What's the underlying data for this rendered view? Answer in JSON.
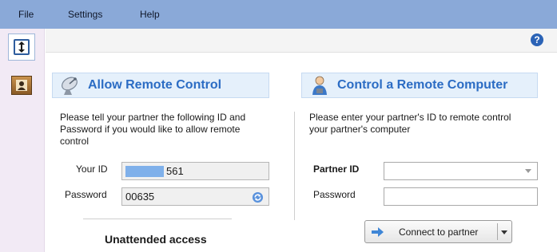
{
  "menu": {
    "file": "File",
    "settings": "Settings",
    "help": "Help"
  },
  "sidebar": {
    "items": [
      {
        "icon": "remote-control-arrows-icon",
        "active": true
      },
      {
        "icon": "contacts-book-icon",
        "active": false
      }
    ]
  },
  "toolbar": {
    "help_icon": "question-mark-icon",
    "help_glyph": "?"
  },
  "allow_panel": {
    "title": "Allow Remote Control",
    "icon": "satellite-dish-icon",
    "description": "Please tell your partner the following ID and Password if you would like to allow remote control",
    "your_id_label": "Your ID",
    "your_id_value": "561",
    "password_label": "Password",
    "password_value": "00635",
    "refresh_icon": "refresh-password-icon",
    "unattended_title": "Unattended access"
  },
  "control_panel": {
    "title": "Control a Remote Computer",
    "icon": "user-computer-icon",
    "description": "Please enter your partner's ID to remote control your partner's computer",
    "partner_id_label": "Partner ID",
    "partner_id_value": "",
    "password_label": "Password",
    "password_value": "",
    "connect_label": "Connect to partner",
    "connect_icon": "arrow-right-icon"
  },
  "colors": {
    "menubar": "#8aa9d8",
    "panel_title": "#2b6cc4",
    "header_bg": "#e5f0fb",
    "sidebar_bg": "#f2eaf5"
  }
}
